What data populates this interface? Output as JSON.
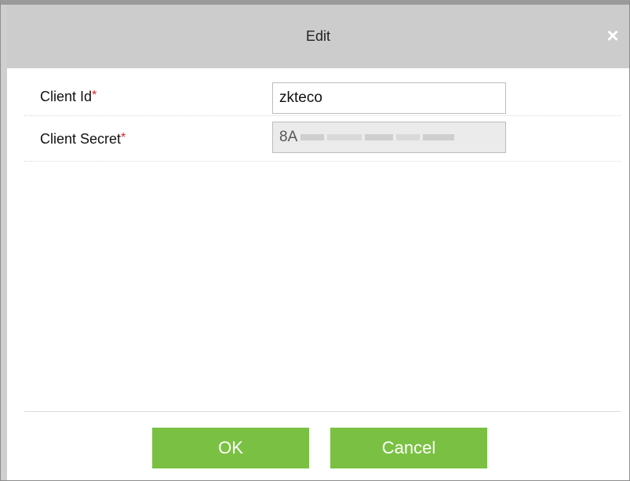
{
  "dialog": {
    "title": "Edit",
    "close_glyph": "×"
  },
  "form": {
    "client_id": {
      "label": "Client Id",
      "required_mark": "*",
      "value": "zkteco"
    },
    "client_secret": {
      "label": "Client Secret",
      "required_mark": "*",
      "value_visible_prefix": "8A"
    }
  },
  "buttons": {
    "ok_label": "OK",
    "cancel_label": "Cancel"
  },
  "colors": {
    "titlebar": "#cccccc",
    "button_green": "#7ac143",
    "required_red": "#e02020"
  },
  "icons": {
    "close": "close-icon"
  }
}
